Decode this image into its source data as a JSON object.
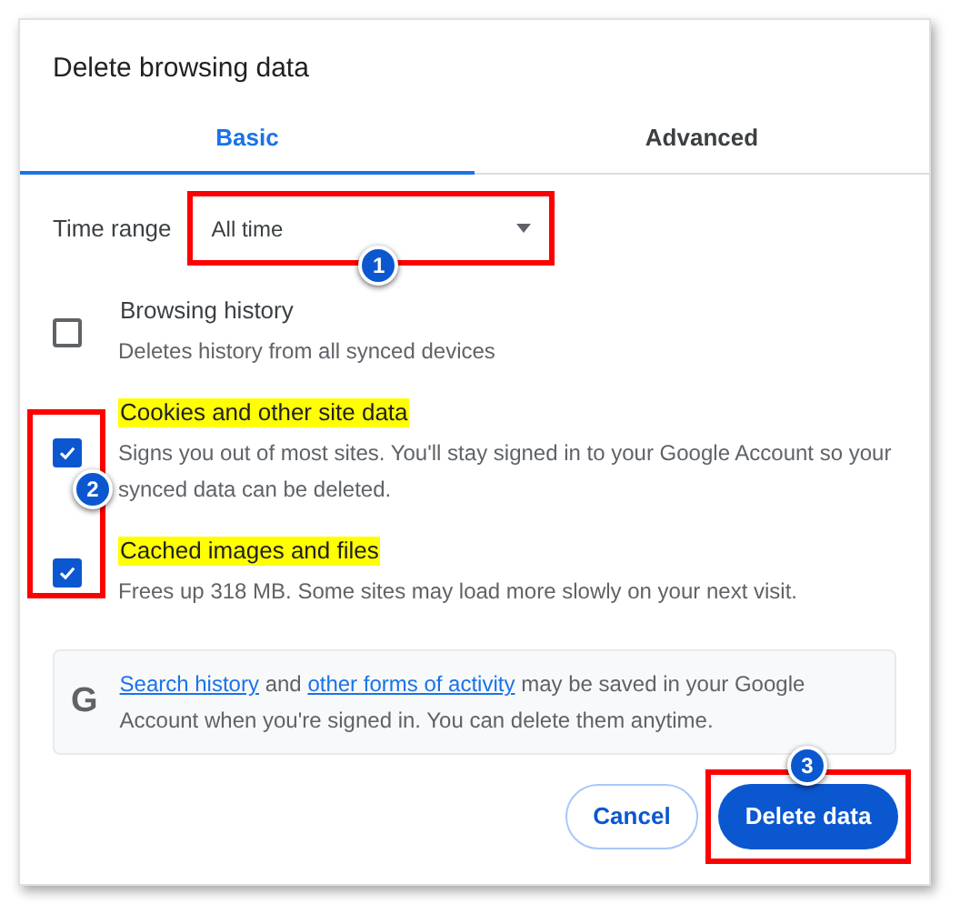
{
  "dialog": {
    "title": "Delete browsing data"
  },
  "tabs": [
    {
      "label": "Basic",
      "selected": true
    },
    {
      "label": "Advanced",
      "selected": false
    }
  ],
  "time_range": {
    "label": "Time range",
    "value": "All time",
    "callout": "1"
  },
  "options_callout": "2",
  "options": [
    {
      "title": "Browsing history",
      "description": "Deletes history from all synced devices",
      "checked": false,
      "highlighted": false
    },
    {
      "title": "Cookies and other site data",
      "description": "Signs you out of most sites. You'll stay signed in to your Google Account so your synced data can be deleted.",
      "checked": true,
      "highlighted": true
    },
    {
      "title": "Cached images and files",
      "description": "Frees up 318 MB. Some sites may load more slowly on your next visit.",
      "checked": true,
      "highlighted": true
    }
  ],
  "info": {
    "logo": "G",
    "parts": [
      {
        "kind": "link",
        "text": "Search history"
      },
      {
        "kind": "text",
        "text": " and "
      },
      {
        "kind": "link",
        "text": "other forms of activity"
      },
      {
        "kind": "text",
        "text": " may be saved in your Google Account when you're signed in. You can delete them anytime."
      }
    ]
  },
  "buttons": {
    "cancel": "Cancel",
    "confirm": "Delete data",
    "confirm_callout": "3"
  }
}
